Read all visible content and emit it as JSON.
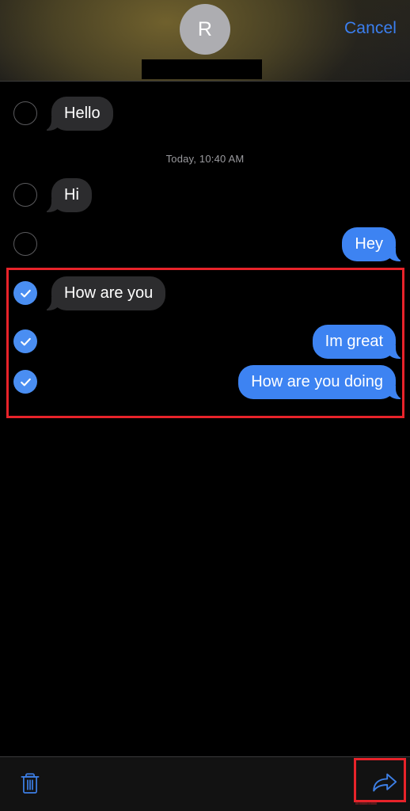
{
  "header": {
    "avatar_initial": "R",
    "avatar_name": "avatar",
    "contact_name_redacted": "",
    "cancel_label": "Cancel",
    "accent_color": "#3b7ff0",
    "avatar_color": "#adadb1"
  },
  "conversation": {
    "timestamp": "Today, 10:40 AM",
    "bubble_colors": {
      "incoming": "#2c2c2e",
      "outgoing": "#3d83f2"
    },
    "messages": [
      {
        "text": "Hello",
        "direction": "incoming",
        "selected": false
      },
      {
        "text": "Hi",
        "direction": "incoming",
        "selected": false
      },
      {
        "text": "Hey",
        "direction": "outgoing",
        "selected": false
      },
      {
        "text": "How are you",
        "direction": "incoming",
        "selected": true
      },
      {
        "text": "Im great",
        "direction": "outgoing",
        "selected": true
      },
      {
        "text": "How are you doing",
        "direction": "outgoing",
        "selected": true
      }
    ]
  },
  "toolbar": {
    "delete_label": "trash-icon",
    "forward_label": "forward-icon",
    "icon_color": "#3d7fe6"
  },
  "annotations": {
    "color": "#e8232a",
    "selection_box_label": "selected-messages-highlight",
    "forward_box_label": "forward-button-highlight",
    "caption": "IIIIIIIIIIIIIIIIIIIIIIIII"
  }
}
